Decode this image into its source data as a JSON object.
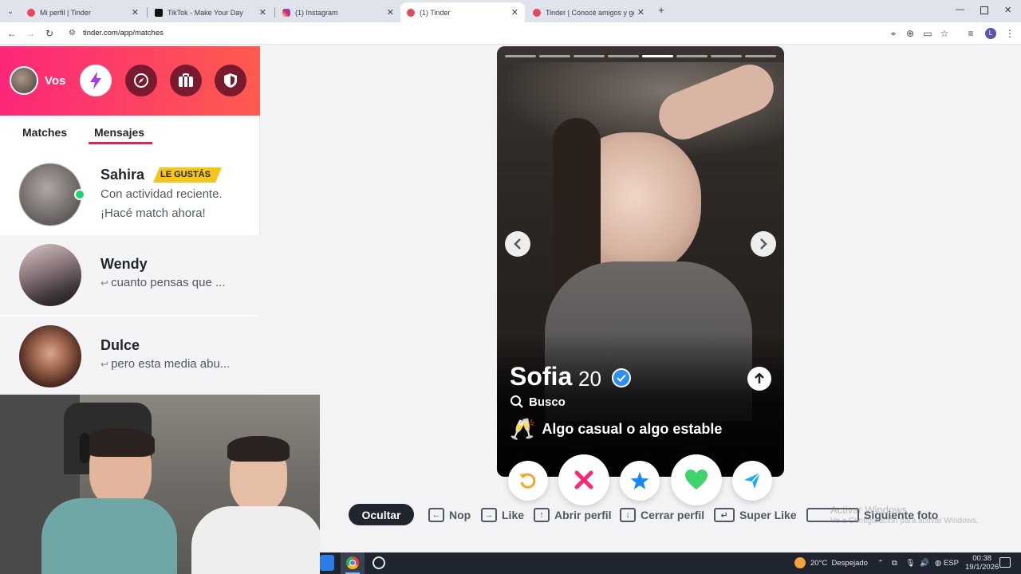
{
  "browser": {
    "tabs": [
      {
        "title": "Mi perfil | Tinder",
        "icon": "tinder-icon",
        "color": "#e8465f"
      },
      {
        "title": "TikTok - Make Your Day",
        "icon": "tiktok-icon",
        "color": "#111111"
      },
      {
        "title": "(1) Instagram",
        "icon": "instagram-icon",
        "color": "#d6249f"
      },
      {
        "title": "(1) Tinder",
        "icon": "tinder-icon",
        "color": "#e8465f"
      },
      {
        "title": "Tinder | Conocé amigos y gente",
        "icon": "tinder-icon",
        "color": "#e8465f"
      }
    ],
    "url": "tinder.com/app/matches"
  },
  "sidebar": {
    "user_label": "Vos",
    "tabs": [
      "Matches",
      "Mensajes"
    ],
    "conversations": [
      {
        "name": "Sahira",
        "badge": "LE GUSTÁS",
        "line1": "Con actividad reciente.",
        "line2": "¡Hacé match ahora!"
      },
      {
        "name": "Wendy",
        "preview": "cuanto pensas que ..."
      },
      {
        "name": "Dulce",
        "preview": "pero esta media abu..."
      }
    ]
  },
  "profile": {
    "name": "Sofia",
    "age": "20",
    "looking_label": "Busco",
    "looking_value": "Algo casual o algo estable",
    "photo_count": 8,
    "current_photo": 5
  },
  "hints": {
    "hide": "Ocultar",
    "nope": "Nop",
    "like": "Like",
    "open": "Abrir perfil",
    "close": "Cerrar perfil",
    "superlike": "Super Like",
    "next_photo": "Siguiente foto"
  },
  "watermark": {
    "line1": "Activar Windows",
    "line2": "Ve a Configuración para activar Windows."
  },
  "taskbar": {
    "weather_temp": "20°C",
    "weather_desc": "Despejado",
    "lang": "ESP",
    "time": "00:38",
    "date": "19/1/2026"
  },
  "colors": {
    "brand_gradient_start": "#fd267a",
    "brand_gradient_end": "#fe5b4e",
    "badge": "#f5c518",
    "active_tab_underline": "#e0245e"
  }
}
